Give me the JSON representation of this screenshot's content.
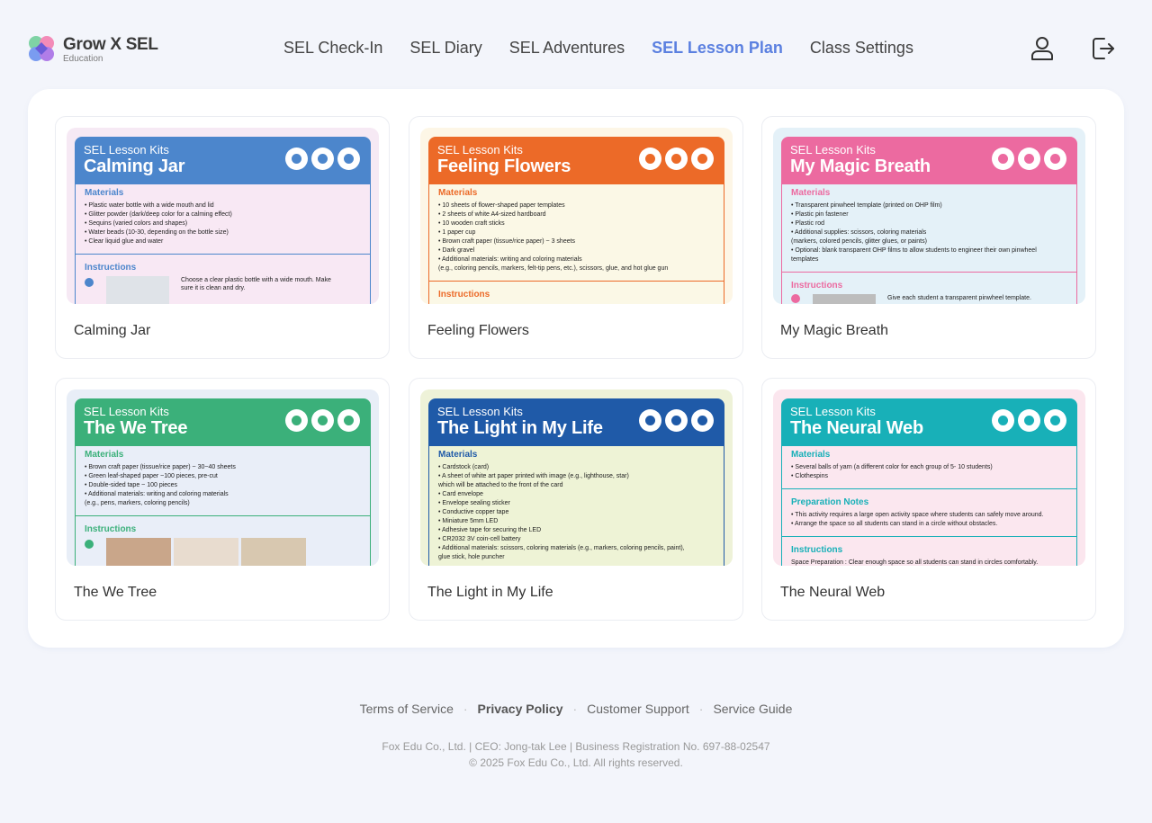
{
  "brand": {
    "name": "Grow X SEL",
    "sub": "Education"
  },
  "nav": [
    {
      "label": "SEL Check-In",
      "active": false
    },
    {
      "label": "SEL Diary",
      "active": false
    },
    {
      "label": "SEL Adventures",
      "active": false
    },
    {
      "label": "SEL Lesson Plan",
      "active": true
    },
    {
      "label": "Class Settings",
      "active": false
    }
  ],
  "header_icons": {
    "profile": "user-icon",
    "logout": "logout-icon"
  },
  "cards": [
    {
      "title": "Calming Jar",
      "eyebrow": "SEL Lesson Kits",
      "kit_name": "Calming Jar",
      "accent": "#4c86cc",
      "bg": "#f6e9f4",
      "body": "#f8e8f4",
      "section1": "Materials",
      "lines": [
        "• Plastic water bottle with a wide mouth and lid",
        "• Glitter powder (dark/deep color for a calming effect)",
        "• Sequins (varied colors and shapes)",
        "• Water beads (10-30, depending on the bottle size)",
        "• Clear liquid glue and water"
      ],
      "section2": "Instructions",
      "step": "Choose a clear plastic bottle with a wide mouth. Make sure it is clean and dry."
    },
    {
      "title": "Feeling Flowers",
      "eyebrow": "SEL Lesson Kits",
      "kit_name": "Feeling Flowers",
      "accent": "#ec6a28",
      "bg": "#fdf6e6",
      "body": "#fbf8e6",
      "section1": "Materials",
      "lines": [
        "• 10 sheets of flower-shaped paper templates",
        "• 2 sheets of white A4-sized hardboard",
        "• 10 wooden craft sticks",
        "• 1 paper cup",
        "• Brown craft paper (tissue/rice paper) ~ 3 sheets",
        "• Dark gravel",
        "• Additional materials: writing and coloring materials",
        "  (e.g., coloring pencils, markers, felt-tip pens, etc.), scissors, glue, and hot glue gun"
      ],
      "section2": "Instructions",
      "step": ""
    },
    {
      "title": "My Magic Breath",
      "eyebrow": "SEL Lesson Kits",
      "kit_name": "My Magic Breath",
      "accent": "#ec6aa0",
      "bg": "#e4f1f8",
      "body": "#e4f1f8",
      "section1": "Materials",
      "lines": [
        "• Transparent pinwheel template (printed on OHP film)",
        "• Plastic pin fastener",
        "• Plastic rod",
        "• Additional supplies: scissors, coloring materials",
        "  (markers, colored pencils, glitter glues, or paints)",
        "• Optional: blank transparent OHP films to allow students to engineer their own pinwheel",
        "  templates"
      ],
      "section2": "Instructions",
      "step": "Give each student a transparent pinwheel template."
    },
    {
      "title": "The We Tree",
      "eyebrow": "SEL Lesson Kits",
      "kit_name": "The We Tree",
      "accent": "#3bb07a",
      "bg": "#e8eef7",
      "body": "#e9eef8",
      "section1": "Materials",
      "lines": [
        "• Brown craft paper (tissue/rice paper) ~ 30~40 sheets",
        "• Green leaf-shaped paper ~100 pieces, pre-cut",
        "• Double-sided tape ~ 100 pieces",
        "• Additional materials: writing and coloring materials",
        "  (e.g., pens, markers, coloring pencils)"
      ],
      "section2": "Instructions",
      "step": ""
    },
    {
      "title": "The Light in My Life",
      "eyebrow": "SEL Lesson Kits",
      "kit_name": "The Light in My Life",
      "accent": "#1f5aa8",
      "bg": "#eef2d8",
      "body": "#eef3d6",
      "section1": "Materials",
      "lines": [
        "• Cardstock (card)",
        "• A sheet of white art paper printed with image (e.g., lighthouse, star)",
        "  which will be attached to the front of the card",
        "• Card envelope",
        "• Envelope sealing sticker",
        "• Conductive copper tape",
        "• Miniature 5mm LED",
        "• Adhesive tape for securing the LED",
        "• CR2032 3V coin-cell battery",
        "• Additional materials: scissors, coloring materials (e.g., markers, coloring pencils, paint),",
        "  glue stick, hole puncher"
      ],
      "section2": "",
      "step": ""
    },
    {
      "title": "The Neural Web",
      "eyebrow": "SEL Lesson Kits",
      "kit_name": "The Neural Web",
      "accent": "#18b0b8",
      "bg": "#fbe6ee",
      "body": "#fbe7ef",
      "section1": "Materials",
      "lines": [
        "• Several balls of yarn (a different color for each group of 5- 10 students)",
        "• Clothespins"
      ],
      "section2": "Preparation Notes",
      "notes": [
        "• This activity requires a large open activity space where students can safely move around.",
        "• Arrange the space so all students can stand in a circle without obstacles."
      ],
      "section3": "Instructions",
      "step": "Space Preparation : Clear enough space so all students can stand in circles comfortably."
    }
  ],
  "footer": {
    "links": [
      {
        "label": "Terms of Service",
        "bold": false
      },
      {
        "label": "Privacy Policy",
        "bold": true
      },
      {
        "label": "Customer Support",
        "bold": false
      },
      {
        "label": "Service Guide",
        "bold": false
      }
    ],
    "company": "Fox Edu Co., Ltd. | CEO: Jong-tak Lee | Business Registration No. 697-88-02547",
    "copyright": "© 2025 Fox Edu Co., Ltd. All rights reserved."
  }
}
